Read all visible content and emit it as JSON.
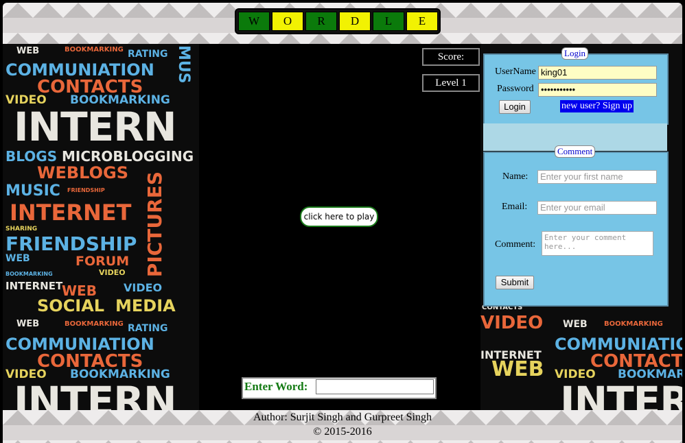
{
  "title_tiles": [
    {
      "letter": "W",
      "color": "#0b7a0b"
    },
    {
      "letter": "O",
      "color": "#f2f202"
    },
    {
      "letter": "R",
      "color": "#0b7a0b"
    },
    {
      "letter": "D",
      "color": "#f2f202"
    },
    {
      "letter": "L",
      "color": "#0b7a0b"
    },
    {
      "letter": "E",
      "color": "#f2f202"
    }
  ],
  "score_label": "Score:",
  "level_label": "Level 1",
  "play_button": "click here to play",
  "enter_word_label": "Enter Word:",
  "enter_word_value": "",
  "login": {
    "legend": "Login",
    "username_label": "UserName",
    "username_value": "king01",
    "password_label": "Password",
    "password_value": "•••••••••••",
    "login_button": "Login",
    "signup_link": "new user? Sign up"
  },
  "comment": {
    "legend": "Comment",
    "name_label": "Name:",
    "name_placeholder": "Enter your first name",
    "email_label": "Email:",
    "email_placeholder": "Enter your email",
    "comment_label": "Comment:",
    "comment_placeholder": "Enter your comment here...",
    "submit_button": "Submit"
  },
  "footer": {
    "author": "Author: Surjit Singh and Gurpreet Singh",
    "copyright": "© 2015-2016"
  },
  "collage_words": {
    "web": "WEB",
    "bookmarking": "BOOKMARKING",
    "rating": "RATING",
    "communiation": "COMMUNIATION",
    "contacts": "CONTACTS",
    "video": "VIDEO",
    "intern": "INTERN",
    "blogs": "BLOGS",
    "microblogging": "MICROBLOGGING",
    "weblogs": "WEBLOGS",
    "music": "MUSIC",
    "internet": "INTERNET",
    "friendship": "FRIENDSHIP",
    "forum": "FORUM",
    "social": "SOCIAL",
    "media": "MEDIA",
    "pictures": "PICTURES",
    "sharing": "SHARING",
    "friendship_small": "FRIENDSHIP",
    "blogs_small": "BLOGS",
    "mus": "MUS"
  },
  "colors": {
    "panel_bg": "#77c5e6",
    "tile_green": "#0b7a0b",
    "tile_yellow": "#f2f202",
    "enter_label": "#137a13",
    "signup_bg": "#0000ee"
  }
}
